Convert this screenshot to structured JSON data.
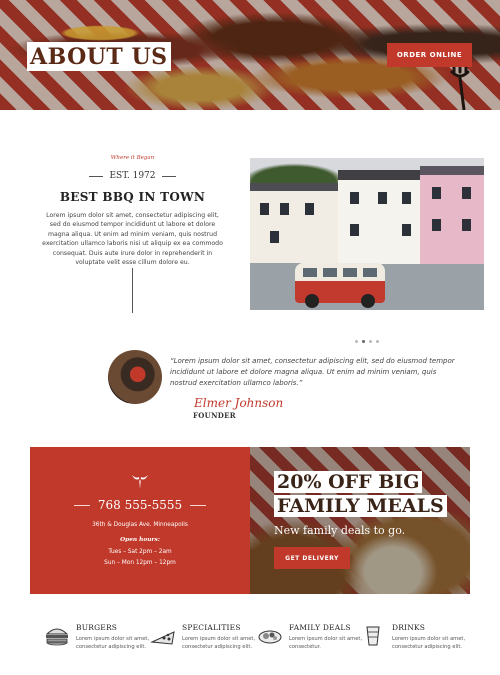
{
  "hero": {
    "title": "ABOUT US",
    "order_button": "ORDER ONLINE"
  },
  "about": {
    "eyebrow": "Where it Began",
    "est": "EST. 1972",
    "heading": "BEST BBQ IN TOWN",
    "body": "Lorem ipsum dolor sit amet, consectetur adipiscing elit, sed do eiusmod tempor incididunt ut labore et dolore magna aliqua. Ut enim ad minim veniam, quis nostrud exercitation ullamco laboris nisi ut aliquip ex ea commodo consequat. Duis aute irure dolor in reprehenderit in voluptate velit esse cillum dolore eu."
  },
  "testimonial": {
    "quote": "“Lorem ipsum dolor sit amet, consectetur adipiscing elit, sed do eiusmod tempor incididunt ut labore et dolore magna aliqua. Ut enim ad minim veniam, quis nostrud exercitation ullamco laboris.”",
    "signature": "Elmer Johnson",
    "role": "FOUNDER"
  },
  "contact": {
    "phone": "768 555-5555",
    "address": "36th & Douglas Ave. Minneapolis",
    "hours_label": "Open hours:",
    "hours": [
      "Tues – Sat  2pm – 2am",
      "Sun – Mon 12pm – 12pm"
    ]
  },
  "promo": {
    "line1": "20% OFF BIG",
    "line2": "FAMILY MEALS",
    "subtitle": "New family deals to go.",
    "button": "GET DELIVERY"
  },
  "categories": [
    {
      "title": "BURGERS",
      "desc": "Lorem ipsum dolor sit amet, consectetur adipiscing elit.",
      "icon": "burger-icon"
    },
    {
      "title": "SPECIALITIES",
      "desc": "Lorem ipsum dolor sit amet, consectetur adipiscing elit.",
      "icon": "pizza-slice-icon"
    },
    {
      "title": "FAMILY DEALS",
      "desc": "Lorem ipsum dolor sit amet, consectetur.",
      "icon": "platter-icon"
    },
    {
      "title": "DRINKS",
      "desc": "Lorem ipsum dolor sit amet, consectetur adipiscing elit.",
      "icon": "drink-glass-icon"
    }
  ],
  "colors": {
    "brand_red": "#c0392b",
    "dark_brown": "#5a2a17"
  }
}
